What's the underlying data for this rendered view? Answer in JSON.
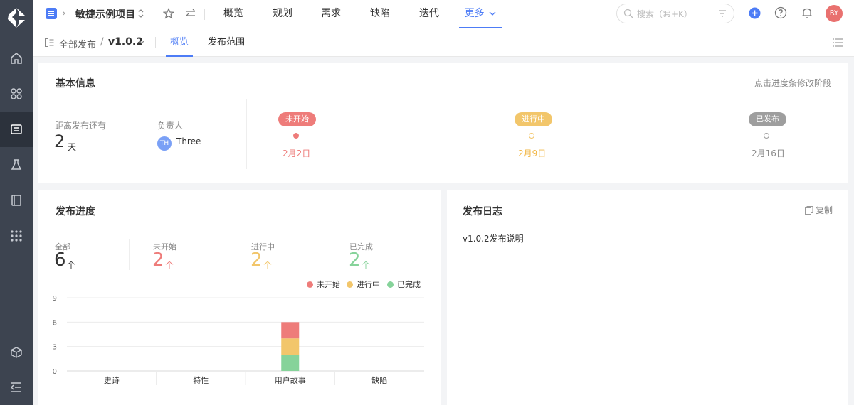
{
  "header": {
    "project_name": "敏捷示例项目",
    "tabs": [
      {
        "label": "概览"
      },
      {
        "label": "规划"
      },
      {
        "label": "需求"
      },
      {
        "label": "缺陷"
      },
      {
        "label": "迭代"
      },
      {
        "label": "更多"
      }
    ],
    "active_tab": "更多",
    "search_placeholder": "搜索（⌘+K）",
    "avatar_initials": "RY"
  },
  "subheader": {
    "all_releases": "全部发布",
    "version": "v1.0.2",
    "tabs": [
      {
        "label": "概览"
      },
      {
        "label": "发布范围"
      }
    ],
    "active_tab": "概览"
  },
  "basic_info": {
    "title": "基本信息",
    "hint": "点击进度条修改阶段",
    "countdown_label": "距离发布还有",
    "countdown_value": "2",
    "countdown_unit": "天",
    "owner_label": "负责人",
    "owner_initials": "TH",
    "owner_name": "Three",
    "timeline": [
      {
        "label": "未开始",
        "date": "2月2日"
      },
      {
        "label": "进行中",
        "date": "2月9日"
      },
      {
        "label": "已发布",
        "date": "2月16日"
      }
    ]
  },
  "release_progress": {
    "title": "发布进度",
    "stats": [
      {
        "label": "全部",
        "value": "6",
        "unit": "个"
      },
      {
        "label": "未开始",
        "value": "2",
        "unit": "个"
      },
      {
        "label": "进行中",
        "value": "2",
        "unit": "个"
      },
      {
        "label": "已完成",
        "value": "2",
        "unit": "个"
      }
    ]
  },
  "release_log": {
    "title": "发布日志",
    "copy_label": "复制",
    "content": "v1.0.2发布说明"
  },
  "colors": {
    "accent": "#4d7cf6",
    "not_started": "#ee7c7a",
    "in_progress": "#f2c66b",
    "done": "#86d39a",
    "released": "#9e9e9e"
  },
  "chart_data": {
    "type": "bar",
    "stacked": true,
    "categories": [
      "史诗",
      "特性",
      "用户故事",
      "缺陷"
    ],
    "series": [
      {
        "name": "已完成",
        "values": [
          0,
          0,
          2,
          0
        ]
      },
      {
        "name": "进行中",
        "values": [
          0,
          0,
          2,
          0
        ]
      },
      {
        "name": "未开始",
        "values": [
          0,
          0,
          2,
          0
        ]
      }
    ],
    "yticks": [
      0,
      3,
      6,
      9
    ],
    "ylim": [
      0,
      9
    ],
    "grid": true,
    "legend_position": "top-right",
    "legend": [
      "未开始",
      "进行中",
      "已完成"
    ]
  }
}
